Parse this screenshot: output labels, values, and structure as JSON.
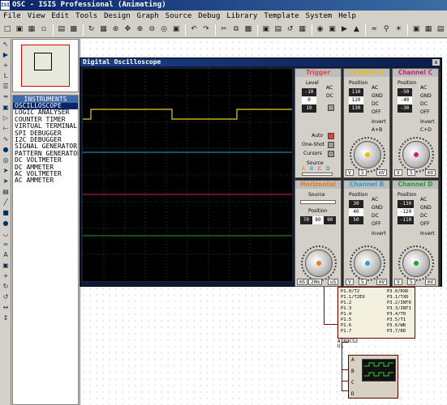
{
  "window": {
    "title": "OSC - ISIS Professional (Animating)",
    "logo": "ISIS"
  },
  "menu": [
    "File",
    "View",
    "Edit",
    "Tools",
    "Design",
    "Graph",
    "Source",
    "Debug",
    "Library",
    "Template",
    "System",
    "Help"
  ],
  "devices_panel": {
    "header": "INSTRUMENTS",
    "items": [
      "OSCILLOSCOPE",
      "LOGIC ANALYSER",
      "COUNTER TIMER",
      "VIRTUAL TERMINAL",
      "SPI DEBUGGER",
      "I2C DEBUGGER",
      "SIGNAL GENERATOR",
      "PATTERN GENERATOR",
      "DC VOLTMETER",
      "DC AMMETER",
      "AC VOLTMETER",
      "AC AMMETER"
    ],
    "selected_index": 0
  },
  "oscilloscope": {
    "title": "Digital Oscilloscope",
    "close_glyph": "x",
    "trigger": {
      "header": "Trigger",
      "level_label": "Level",
      "level_readout": [
        "-10",
        "0",
        "10"
      ],
      "ac": "AC",
      "dc": "DC",
      "auto": "Auto",
      "one_shot": "One-Shot",
      "cursors": "Cursors",
      "source_label": "Source",
      "source_letters": [
        "A",
        "B",
        "C",
        "D"
      ]
    },
    "horizontal": {
      "header": "Horizontal",
      "source_label": "Source",
      "position_label": "Position",
      "position_readout": [
        "70",
        "80",
        "90"
      ],
      "knob_labels": [
        "mS",
        "20m",
        "uS"
      ]
    },
    "channels": [
      {
        "header": "Channel A",
        "color": "#e6d020",
        "position_label": "Position",
        "readout": [
          "110",
          "120",
          "130"
        ],
        "ac": "AC",
        "gnd": "GND",
        "dc": "DC",
        "off": "OFF",
        "invert": "Invert",
        "mode": "A+B",
        "knob_labels": [
          "V",
          "5",
          "mV"
        ]
      },
      {
        "header": "Channel B",
        "color": "#2aa0d0",
        "position_label": "Position",
        "readout": [
          "30",
          "40",
          "50"
        ],
        "ac": "AC",
        "gnd": "GND",
        "dc": "DC",
        "off": "OFF",
        "invert": "Invert",
        "mode": "",
        "knob_labels": [
          "V",
          "5",
          "mV"
        ]
      },
      {
        "header": "Channel C",
        "color": "#d02070",
        "position_label": "Position",
        "readout": [
          "-50",
          "-40",
          "-30"
        ],
        "ac": "AC",
        "gnd": "GND",
        "dc": "DC",
        "off": "OFF",
        "invert": "Invert",
        "mode": "C+D",
        "knob_labels": [
          "V",
          "5",
          "mV"
        ]
      },
      {
        "header": "Channel D",
        "color": "#20a030",
        "position_label": "Position",
        "readout": [
          "-130",
          "-120",
          "-110"
        ],
        "ac": "AC",
        "gnd": "GND",
        "dc": "DC",
        "off": "OFF",
        "invert": "Invert",
        "mode": "",
        "knob_labels": [
          "V",
          "5",
          "mV"
        ]
      }
    ],
    "trace_colors": {
      "a": "#e6d020",
      "b": "#2aa0d0",
      "c": "#d02070",
      "d": "#20a030"
    }
  },
  "schematic": {
    "mcu": {
      "name": "AT89C52",
      "ref": "U1",
      "left_pins": [
        "P1.0/T2",
        "P1.1/T2EX",
        "P1.2",
        "P1.3",
        "P1.4",
        "P1.5",
        "P1.6",
        "P1.7"
      ],
      "left_nums": [
        "1",
        "2",
        "3",
        "4",
        "5",
        "6",
        "7",
        "8"
      ],
      "right_pins": [
        "P3.0/RXD",
        "P3.1/TXD",
        "P3.2/INT0",
        "P3.3/INT1",
        "P3.4/T0",
        "P3.5/T1",
        "P3.6/WR",
        "P3.7/RD"
      ],
      "right_nums": [
        "10",
        "11",
        "12",
        "13",
        "14",
        "15",
        "16",
        "17"
      ]
    },
    "scope_inputs": [
      "A",
      "B",
      "C",
      "D"
    ]
  }
}
